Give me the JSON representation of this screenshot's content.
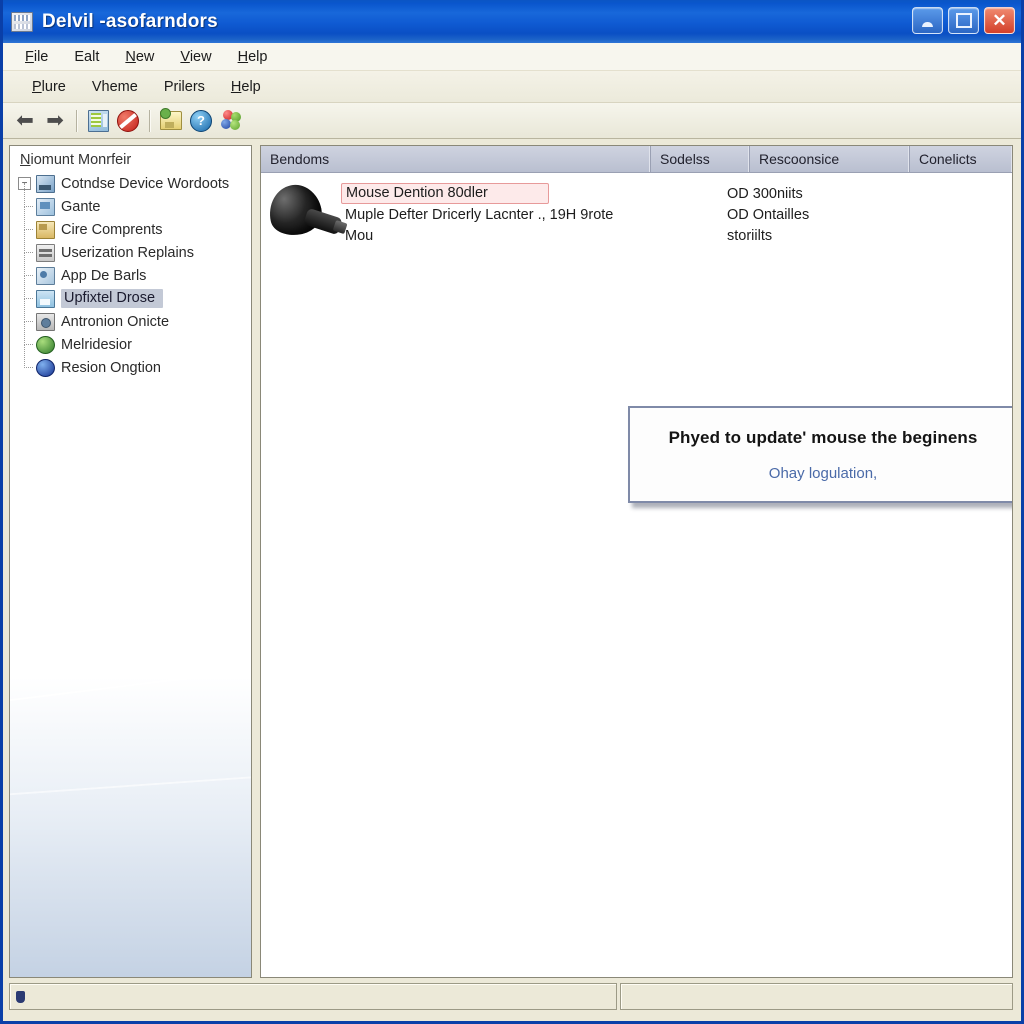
{
  "window": {
    "title": "Delvil -asofarndors",
    "icon": "device-manager-icon",
    "buttons": {
      "minimize": "_",
      "maximize": "□",
      "close": "✕"
    }
  },
  "menubar": {
    "items": [
      {
        "name": "file",
        "label": "File",
        "accel": "F"
      },
      {
        "name": "edit",
        "label": "Ealt",
        "accel": "E"
      },
      {
        "name": "new",
        "label": "New",
        "accel": "N"
      },
      {
        "name": "view",
        "label": "View",
        "accel": "V"
      },
      {
        "name": "help",
        "label": "Help",
        "accel": "H"
      }
    ]
  },
  "menubar2": {
    "items": [
      {
        "name": "plure",
        "label": "Plure"
      },
      {
        "name": "vheme",
        "label": "Vheme"
      },
      {
        "name": "prilers",
        "label": "Prilers"
      },
      {
        "name": "help2",
        "label": "Help"
      }
    ]
  },
  "toolbar": {
    "back_icon": "back-arrow-icon",
    "forward_icon": "forward-arrow-icon",
    "properties_icon": "properties-icon",
    "disable_icon": "disable-device-icon",
    "update_icon": "update-driver-icon",
    "help_icon": "help-icon",
    "scan_icon": "scan-hardware-icon",
    "back_glyph": "⬅",
    "forward_glyph": "➡",
    "help_glyph": "?"
  },
  "sidebar": {
    "root_label": "Niomunt Monrfeir",
    "tree": [
      {
        "name": "computer-root",
        "label": "Cotndse Device Wordoots",
        "icon": "computer-icon",
        "level": 0,
        "expanded": true,
        "expander": "−"
      },
      {
        "name": "gante",
        "label": "Gante",
        "icon": "monitor-icon",
        "level": 1,
        "selected": false
      },
      {
        "name": "cire-components",
        "label": "Cire Comprents",
        "icon": "folder-icon",
        "level": 1,
        "selected": false
      },
      {
        "name": "userization",
        "label": "Userization Replains",
        "icon": "stack-icon",
        "level": 1,
        "selected": false
      },
      {
        "name": "app-de-barls",
        "label": "App De Barls",
        "icon": "app-icon",
        "level": 1,
        "selected": false
      },
      {
        "name": "upfixtel-drose",
        "label": "Upfixtel Drose",
        "icon": "save-icon",
        "level": 1,
        "selected": true
      },
      {
        "name": "antronion",
        "label": "Antronion Onicte",
        "icon": "camera-icon",
        "level": 1,
        "selected": false
      },
      {
        "name": "melridesior",
        "label": "Melridesior",
        "icon": "globe-green-icon",
        "level": 1,
        "selected": false
      },
      {
        "name": "resion-ongtion",
        "label": "Resion Ongtion",
        "icon": "globe-blue-icon",
        "level": 1,
        "selected": false
      }
    ]
  },
  "list": {
    "columns": [
      {
        "name": "col-bendoms",
        "label": "Bendoms"
      },
      {
        "name": "col-sodelss",
        "label": "Sodelss"
      },
      {
        "name": "col-rescoonsice",
        "label": "Rescoonsice"
      },
      {
        "name": "col-conelicts",
        "label": "Conelicts"
      },
      {
        "name": "col-empty",
        "label": ""
      }
    ],
    "device_icon": "mouse-device-icon",
    "rows": [
      {
        "name": "row-1",
        "text": "Mouse Dention 80dler",
        "resource": "OD 300niits",
        "highlighted": true
      },
      {
        "name": "row-2",
        "text": "Muple Defter Dricerly Lacnter ., 19H 9rote",
        "resource": "OD Ontailles",
        "highlighted": false
      },
      {
        "name": "row-3",
        "text": "Mou",
        "resource": "storiilts",
        "highlighted": false
      }
    ]
  },
  "dialog": {
    "name": "update-failed-dialog",
    "message": "Phyed to update' mouse the beginens",
    "link": "Ohay logulation,"
  },
  "statusbar": {
    "icon": "status-icon",
    "left_text": "",
    "right_text": ""
  },
  "colors": {
    "titlebar_blue": "#0a56cd",
    "accent_red": "#c21f18",
    "highlight_selection": "#c3c9d6",
    "error_box_border": "#e79a9a",
    "link": "#4a6aa8"
  }
}
